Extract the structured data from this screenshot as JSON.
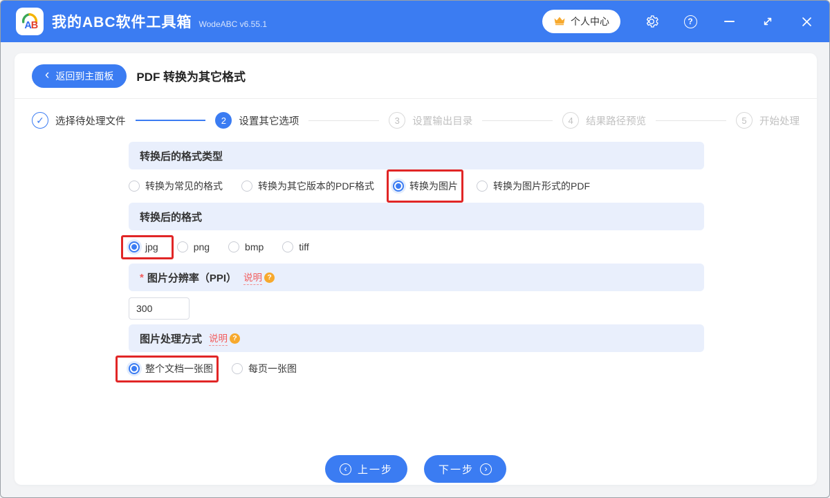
{
  "titlebar": {
    "app_title": "我的ABC软件工具箱",
    "version": "WodeABC v6.55.1",
    "user_center_label": "个人中心",
    "help_glyph": "?"
  },
  "header": {
    "back_label": "返回到主面板",
    "page_title": "PDF 转换为其它格式"
  },
  "steps": [
    {
      "number": "✓",
      "label": "选择待处理文件",
      "state": "done"
    },
    {
      "number": "2",
      "label": "设置其它选项",
      "state": "active"
    },
    {
      "number": "3",
      "label": "设置输出目录",
      "state": "pending"
    },
    {
      "number": "4",
      "label": "结果路径预览",
      "state": "pending"
    },
    {
      "number": "5",
      "label": "开始处理",
      "state": "pending"
    }
  ],
  "form": {
    "format_type": {
      "title": "转换后的格式类型",
      "options": [
        {
          "label": "转换为常见的格式",
          "selected": false
        },
        {
          "label": "转换为其它版本的PDF格式",
          "selected": false
        },
        {
          "label": "转换为图片",
          "selected": true,
          "annotated": true
        },
        {
          "label": "转换为图片形式的PDF",
          "selected": false
        }
      ]
    },
    "image_format": {
      "title": "转换后的格式",
      "options": [
        {
          "label": "jpg",
          "selected": true,
          "annotated": true
        },
        {
          "label": "png",
          "selected": false
        },
        {
          "label": "bmp",
          "selected": false
        },
        {
          "label": "tiff",
          "selected": false
        }
      ]
    },
    "resolution": {
      "required_mark": "*",
      "title": "图片分辨率（PPI）",
      "help_link": "说明",
      "value": "300"
    },
    "processing_mode": {
      "title": "图片处理方式",
      "help_link": "说明",
      "options": [
        {
          "label": "整个文档一张图",
          "selected": true,
          "annotated": true
        },
        {
          "label": "每页一张图",
          "selected": false
        }
      ]
    }
  },
  "footer": {
    "prev_label": "上一步",
    "next_label": "下一步"
  },
  "colors": {
    "primary_blue": "#3b7cf2",
    "section_header_bg": "#e9effc",
    "annotation_red": "#e12626",
    "help_link_red": "#f25b5b",
    "help_badge_orange": "#f7a92d"
  }
}
